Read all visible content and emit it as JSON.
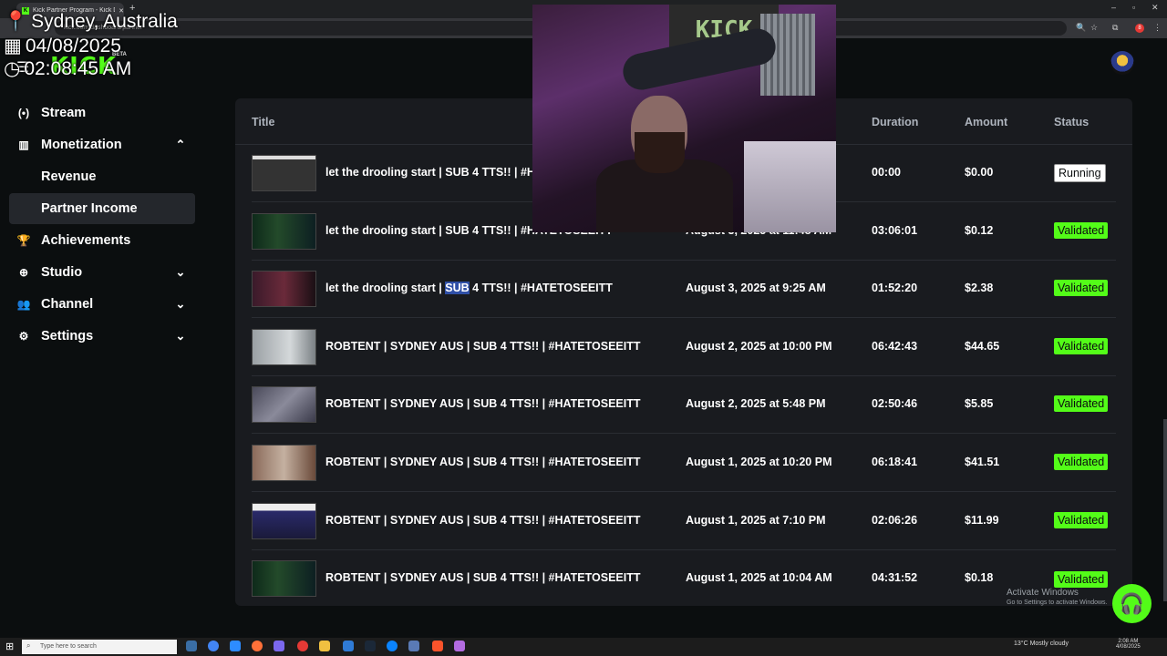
{
  "browser": {
    "tab_title": "Kick Partner Program - Kick Da",
    "tab_close": "✕",
    "new_tab": "+",
    "url": "kick.com/dashboard/partner",
    "window_controls": [
      "–",
      "▫",
      "✕"
    ],
    "extension_badge": "8"
  },
  "overlay": {
    "location": "Sydney, Australia",
    "date": "04/08/2025",
    "time": "02:08:45 AM"
  },
  "logo": {
    "text": "KICK",
    "badge": "BETA"
  },
  "sidebar": {
    "items": [
      {
        "label": "Stream",
        "icon": "broadcast-icon"
      },
      {
        "label": "Monetization",
        "icon": "chart-icon",
        "chevron": "up"
      },
      {
        "label": "Revenue",
        "sub": true
      },
      {
        "label": "Partner Income",
        "sub": true,
        "active": true
      },
      {
        "label": "Achievements",
        "icon": "trophy-icon"
      },
      {
        "label": "Studio",
        "icon": "studio-icon",
        "chevron": "down"
      },
      {
        "label": "Channel",
        "icon": "users-icon",
        "chevron": "down"
      },
      {
        "label": "Settings",
        "icon": "gear-icon",
        "chevron": "down"
      }
    ]
  },
  "table": {
    "headers": {
      "title": "Title",
      "duration": "Duration",
      "amount": "Amount",
      "status": "Status"
    },
    "rows": [
      {
        "title": "let the drooling start | SUB 4 TTS!! | #H",
        "date": "",
        "duration": "00:00",
        "amount": "$0.00",
        "status": "Running"
      },
      {
        "title": "let the drooling start | SUB 4 TTS!! | #HATETOSEEITT",
        "date": "August 3, 2025 at 11:48 AM",
        "duration": "03:06:01",
        "amount": "$0.12",
        "status": "Validated"
      },
      {
        "title_pre": "let the drooling start | ",
        "title_hl": "SUB",
        "title_post": " 4 TTS!! | #HATETOSEEITT",
        "date": "August 3, 2025 at 9:25 AM",
        "duration": "01:52:20",
        "amount": "$2.38",
        "status": "Validated"
      },
      {
        "title": "ROBTENT | SYDNEY AUS | SUB 4 TTS!! | #HATETOSEEITT",
        "date": "August 2, 2025 at 10:00 PM",
        "duration": "06:42:43",
        "amount": "$44.65",
        "status": "Validated"
      },
      {
        "title": "ROBTENT | SYDNEY AUS | SUB 4 TTS!! | #HATETOSEEITT",
        "date": "August 2, 2025 at 5:48 PM",
        "duration": "02:50:46",
        "amount": "$5.85",
        "status": "Validated"
      },
      {
        "title": "ROBTENT | SYDNEY AUS | SUB 4 TTS!! | #HATETOSEEITT",
        "date": "August 1, 2025 at 10:20 PM",
        "duration": "06:18:41",
        "amount": "$41.51",
        "status": "Validated"
      },
      {
        "title": "ROBTENT | SYDNEY AUS | SUB 4 TTS!! | #HATETOSEEITT",
        "date": "August 1, 2025 at 7:10 PM",
        "duration": "02:06:26",
        "amount": "$11.99",
        "status": "Validated"
      },
      {
        "title": "ROBTENT | SYDNEY AUS | SUB 4 TTS!! | #HATETOSEEITT",
        "date": "August 1, 2025 at 10:04 AM",
        "duration": "04:31:52",
        "amount": "$0.18",
        "status": "Validated"
      }
    ]
  },
  "webcam": {
    "banner_text": "KICK"
  },
  "windows": {
    "activate_title": "Activate Windows",
    "activate_sub": "Go to Settings to activate Windows.",
    "search_placeholder": "Type here to search",
    "weather": "13°C  Mostly cloudy",
    "clock_time": "2:08 AM",
    "clock_date": "4/08/2025"
  },
  "colors": {
    "accent": "#53fc18",
    "background": "#0b0e0f",
    "panel": "#191b1f"
  }
}
